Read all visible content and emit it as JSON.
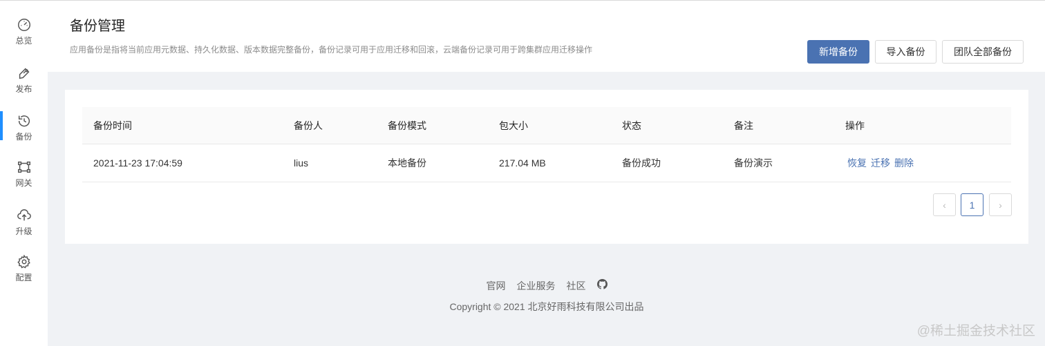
{
  "sidebar": {
    "items": [
      {
        "label": "总览",
        "icon": "dashboard-icon"
      },
      {
        "label": "发布",
        "icon": "publish-icon"
      },
      {
        "label": "备份",
        "icon": "backup-icon",
        "active": true
      },
      {
        "label": "网关",
        "icon": "gateway-icon"
      },
      {
        "label": "升级",
        "icon": "upgrade-icon"
      },
      {
        "label": "配置",
        "icon": "settings-icon"
      }
    ]
  },
  "header": {
    "title": "备份管理",
    "description": "应用备份是指将当前应用元数据、持久化数据、版本数据完整备份，备份记录可用于应用迁移和回滚，云端备份记录可用于跨集群应用迁移操作",
    "buttons": {
      "add": "新增备份",
      "import": "导入备份",
      "team_all": "团队全部备份"
    },
    "accent_color": "#4a72b2"
  },
  "table": {
    "columns": [
      "备份时间",
      "备份人",
      "备份模式",
      "包大小",
      "状态",
      "备注",
      "操作"
    ],
    "rows": [
      {
        "time": "2021-11-23 17:04:59",
        "user": "lius",
        "mode": "本地备份",
        "size": "217.04 MB",
        "status": "备份成功",
        "note": "备份演示",
        "actions": [
          "恢复",
          "迁移",
          "删除"
        ]
      }
    ]
  },
  "pagination": {
    "prev": "‹",
    "current": "1",
    "next": "›"
  },
  "footer": {
    "links": [
      "官网",
      "企业服务",
      "社区"
    ],
    "github_icon": "github-icon",
    "copyright": "Copyright © 2021 北京好雨科技有限公司出品"
  },
  "watermark": "@稀土掘金技术社区"
}
